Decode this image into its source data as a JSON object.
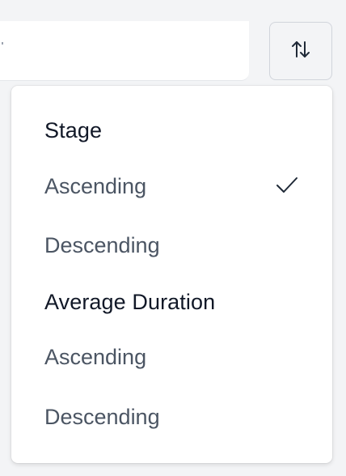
{
  "sort_button": {
    "icon": "sort-arrows-icon"
  },
  "sort_menu": {
    "groups": [
      {
        "label": "Stage",
        "options": [
          {
            "label": "Ascending",
            "selected": true
          },
          {
            "label": "Descending",
            "selected": false
          }
        ]
      },
      {
        "label": "Average Duration",
        "options": [
          {
            "label": "Ascending",
            "selected": false
          },
          {
            "label": "Descending",
            "selected": false
          }
        ]
      }
    ]
  },
  "colors": {
    "header_text": "#111827",
    "option_text": "#4b5563",
    "check": "#1f2937"
  }
}
